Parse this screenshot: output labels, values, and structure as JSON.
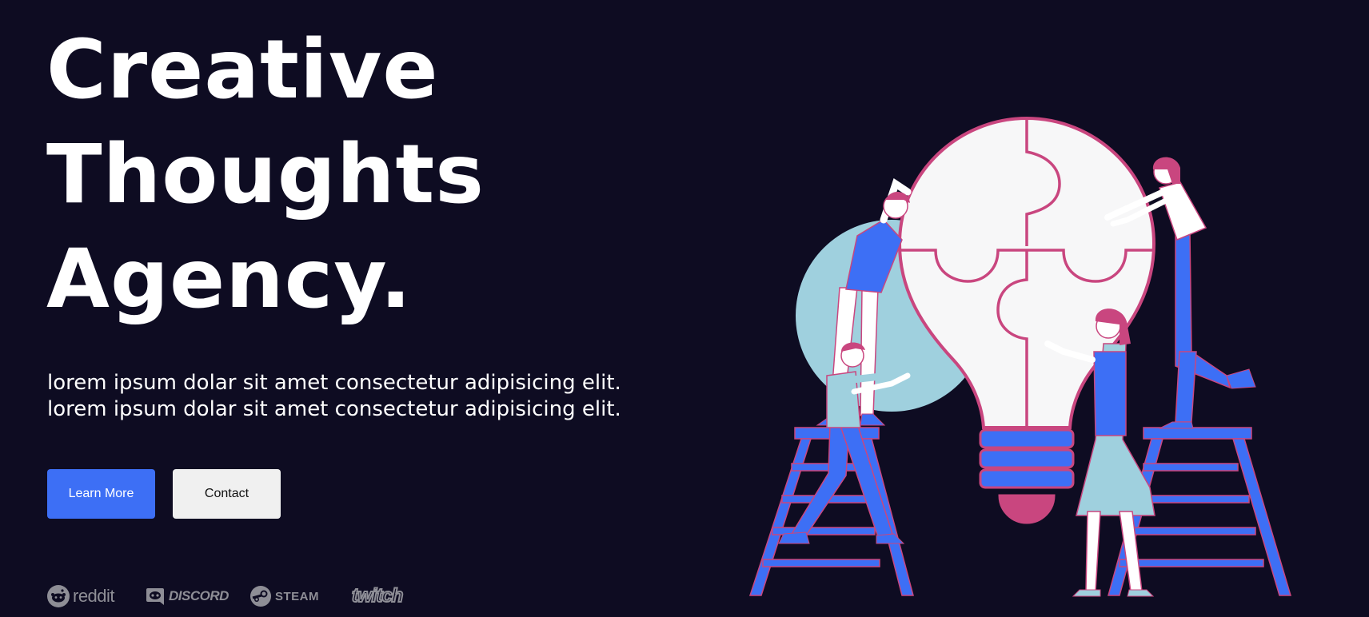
{
  "hero": {
    "title_lines": [
      "Creative",
      "Thoughts",
      "Agency."
    ],
    "subtitle_lines": [
      "lorem ipsum dolar sit amet consectetur adipisicing elit.",
      "lorem ipsum dolar sit amet consectetur adipisicing elit."
    ],
    "buttons": {
      "learn_more": "Learn More",
      "contact": "Contact"
    }
  },
  "brands": [
    {
      "name": "reddit",
      "icon": "reddit-icon"
    },
    {
      "name": "DISCORD",
      "icon": "discord-icon"
    },
    {
      "name": "STEAM",
      "icon": "steam-icon"
    },
    {
      "name": "twitch",
      "icon": "twitch-logo"
    }
  ],
  "colors": {
    "background": "#0e0c22",
    "primary": "#3d6ff5",
    "secondary_button": "#f0f0f0",
    "text": "#ffffff",
    "brand_gray": "#8e8e96",
    "illustration_blue": "#3d6ff5",
    "illustration_pink": "#c9467f",
    "illustration_light_blue": "#9fd0de",
    "bulb_white": "#f7f7f8"
  },
  "illustration": {
    "subject": "people-assembling-lightbulb-puzzle"
  }
}
